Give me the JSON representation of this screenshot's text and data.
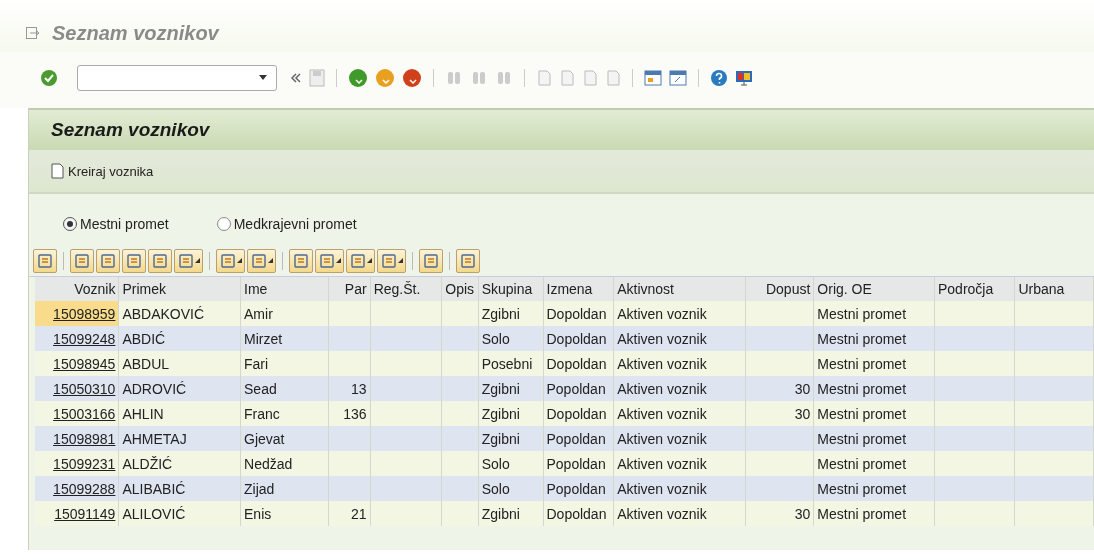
{
  "window": {
    "title": "Seznam voznikov"
  },
  "panel": {
    "title": "Seznam voznikov",
    "create_button": "Kreiraj voznika"
  },
  "radios": [
    {
      "label": "Mestni promet",
      "selected": true
    },
    {
      "label": "Medkrajevni promet",
      "selected": false
    }
  ],
  "table": {
    "columns": [
      {
        "label": "Voznik",
        "kind": "link"
      },
      {
        "label": "Primek",
        "kind": "text"
      },
      {
        "label": "Ime",
        "kind": "text"
      },
      {
        "label": "Par",
        "kind": "number"
      },
      {
        "label": "Reg.Št.",
        "kind": "text"
      },
      {
        "label": "Opis",
        "kind": "text"
      },
      {
        "label": "Skupina",
        "kind": "text"
      },
      {
        "label": "Izmena",
        "kind": "text"
      },
      {
        "label": "Aktivnost",
        "kind": "text"
      },
      {
        "label": "Dopust",
        "kind": "number"
      },
      {
        "label": "Orig. OE",
        "kind": "text"
      },
      {
        "label": "Področja",
        "kind": "text"
      },
      {
        "label": "Urbana",
        "kind": "text"
      }
    ],
    "rows": [
      {
        "current": true,
        "cells": [
          "15098959",
          "ABDAKOVIĆ",
          "Amir",
          "",
          "",
          "",
          "Zgibni",
          "Dopoldan",
          "Aktiven voznik",
          "",
          "Mestni promet",
          "",
          ""
        ]
      },
      {
        "current": false,
        "cells": [
          "15099248",
          "ABDIĆ",
          "Mirzet",
          "",
          "",
          "",
          "Solo",
          "Dopoldan",
          "Aktiven voznik",
          "",
          "Mestni promet",
          "",
          ""
        ]
      },
      {
        "current": false,
        "cells": [
          "15098945",
          "ABDUL",
          "Fari",
          "",
          "",
          "",
          "Posebni",
          "Dopoldan",
          "Aktiven voznik",
          "",
          "Mestni promet",
          "",
          ""
        ]
      },
      {
        "current": false,
        "cells": [
          "15050310",
          "ADROVIĆ",
          "Sead",
          "13",
          "",
          "",
          "Zgibni",
          "Popoldan",
          "Aktiven voznik",
          "30",
          "Mestni promet",
          "",
          ""
        ]
      },
      {
        "current": false,
        "cells": [
          "15003166",
          "AHLIN",
          "Franc",
          "136",
          "",
          "",
          "Zgibni",
          "Dopoldan",
          "Aktiven voznik",
          "30",
          "Mestni promet",
          "",
          ""
        ]
      },
      {
        "current": false,
        "cells": [
          "15098981",
          "AHMETAJ",
          "Gjevat",
          "",
          "",
          "",
          "Zgibni",
          "Popoldan",
          "Aktiven voznik",
          "",
          "Mestni promet",
          "",
          ""
        ]
      },
      {
        "current": false,
        "cells": [
          "15099231",
          "ALDŽIĆ",
          "Nedžad",
          "",
          "",
          "",
          "Solo",
          "Popoldan",
          "Aktiven voznik",
          "",
          "Mestni promet",
          "",
          ""
        ]
      },
      {
        "current": false,
        "cells": [
          "15099288",
          "ALIBABIĆ",
          "Zijad",
          "",
          "",
          "",
          "Solo",
          "Popoldan",
          "Aktiven voznik",
          "",
          "Mestni promet",
          "",
          ""
        ]
      },
      {
        "current": false,
        "cells": [
          "15091149",
          "ALILOVIĆ",
          "Enis",
          "21",
          "",
          "",
          "Zgibni",
          "Dopoldan",
          "Aktiven voznik",
          "30",
          "Mestni promet",
          "",
          ""
        ]
      }
    ]
  }
}
